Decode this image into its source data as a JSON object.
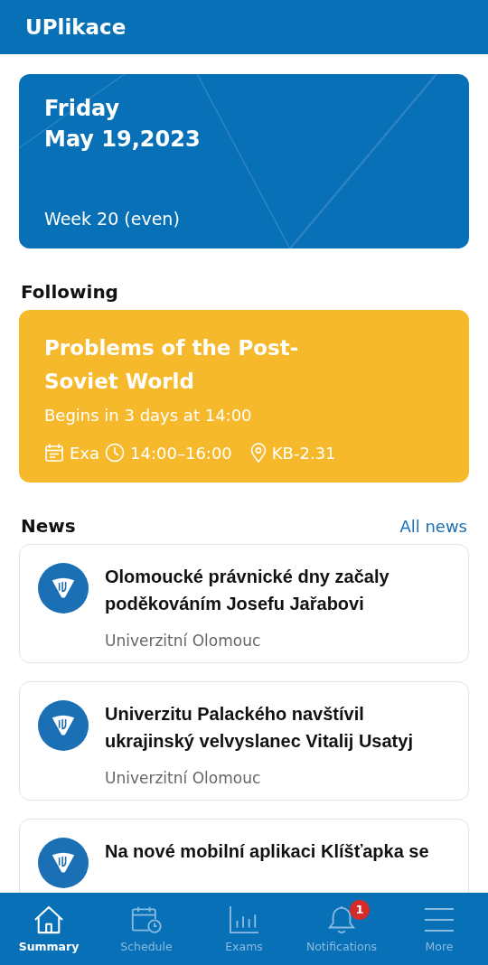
{
  "app_bar": {
    "title": "UPlikace"
  },
  "date_card": {
    "day": "Friday",
    "date": "May 19,2023",
    "week": "Week 20 (even)"
  },
  "following": {
    "heading": "Following",
    "title": "Problems of the Post-Soviet World",
    "begins": "Begins in 3 days at 14:00",
    "type": "Exa",
    "time": "14:00–16:00",
    "room": "KB-2.31"
  },
  "news": {
    "heading": "News",
    "all_link": "All news",
    "items": [
      {
        "title": "Olomoucké právnické dny začaly poděkováním Josefu Jařabovi",
        "source": "Univerzitní Olomouc"
      },
      {
        "title": "Univerzitu Palackého navštívil ukrajinský velvyslanec Vitalij Usatyj",
        "source": "Univerzitní Olomouc"
      },
      {
        "title": "Na nové mobilní aplikaci Klíšťapka se"
      }
    ]
  },
  "tabs": [
    {
      "label": "Summary",
      "selected": true
    },
    {
      "label": "Schedule",
      "selected": false
    },
    {
      "label": "Exams",
      "selected": false
    },
    {
      "label": "Notifications",
      "selected": false,
      "badge": "1"
    },
    {
      "label": "More",
      "selected": false
    }
  ]
}
